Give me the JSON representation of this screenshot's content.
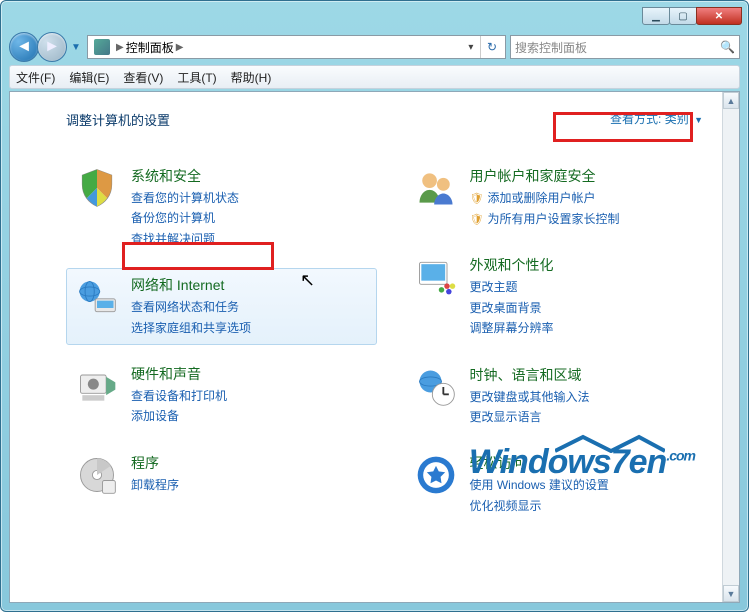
{
  "titlebar": {
    "min": "",
    "max": "",
    "close": ""
  },
  "nav": {
    "path_root": "控制面板",
    "path_sep": "▶",
    "refresh": "↻",
    "search_placeholder": "搜索控制面板"
  },
  "menu": {
    "file": "文件(F)",
    "edit": "编辑(E)",
    "view": "查看(V)",
    "tools": "工具(T)",
    "help": "帮助(H)"
  },
  "page": {
    "title": "调整计算机的设置",
    "view_label": "查看方式:",
    "view_value": "类别"
  },
  "left": [
    {
      "title": "系统和安全",
      "links": [
        "查看您的计算机状态",
        "备份您的计算机",
        "查找并解决问题"
      ],
      "shield": [
        false,
        false,
        false
      ]
    },
    {
      "title": "网络和 Internet",
      "links": [
        "查看网络状态和任务",
        "选择家庭组和共享选项"
      ],
      "shield": [
        false,
        false
      ],
      "hover": true
    },
    {
      "title": "硬件和声音",
      "links": [
        "查看设备和打印机",
        "添加设备"
      ],
      "shield": [
        false,
        false
      ]
    },
    {
      "title": "程序",
      "links": [
        "卸载程序"
      ],
      "shield": [
        false
      ]
    }
  ],
  "right": [
    {
      "title": "用户帐户和家庭安全",
      "links": [
        "添加或删除用户帐户",
        "为所有用户设置家长控制"
      ],
      "shield": [
        true,
        true
      ]
    },
    {
      "title": "外观和个性化",
      "links": [
        "更改主题",
        "更改桌面背景",
        "调整屏幕分辨率"
      ],
      "shield": [
        false,
        false,
        false
      ]
    },
    {
      "title": "时钟、语言和区域",
      "links": [
        "更改键盘或其他输入法",
        "更改显示语言"
      ],
      "shield": [
        false,
        false
      ]
    },
    {
      "title": "轻松访问",
      "links": [
        "使用 Windows 建议的设置",
        "优化视频显示"
      ],
      "shield": [
        false,
        false
      ]
    }
  ],
  "watermark": "Windows7en",
  "watermark_sup": ".com"
}
